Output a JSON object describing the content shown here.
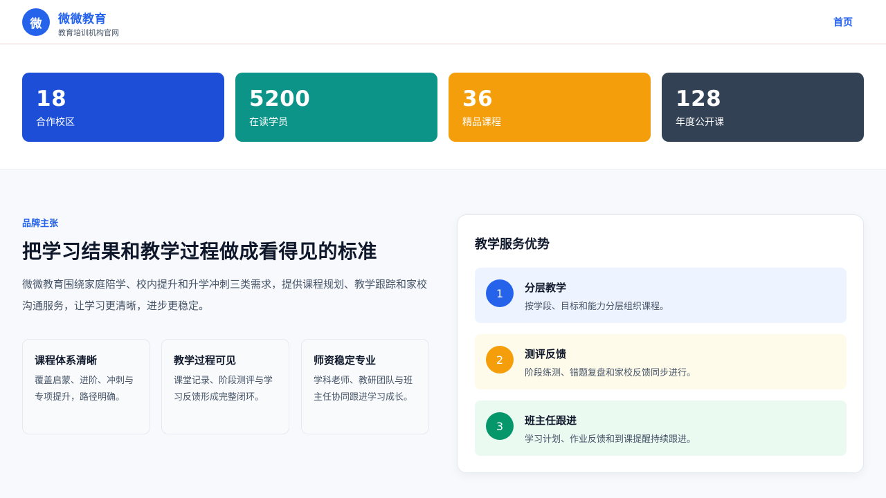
{
  "header": {
    "logo_char": "微",
    "brand_name": "微微教育",
    "brand_subtitle": "教育培训机构官网",
    "nav_home": "首页",
    "accent": "#2563eb"
  },
  "stats": [
    {
      "value": "18",
      "label": "合作校区",
      "color": "#1d4ed8"
    },
    {
      "value": "5200",
      "label": "在读学员",
      "color": "#0d9488"
    },
    {
      "value": "36",
      "label": "精品课程",
      "color": "#f59e0b"
    },
    {
      "value": "128",
      "label": "年度公开课",
      "color": "#334155"
    }
  ],
  "hero": {
    "eyebrow": "品牌主张",
    "headline": "把学习结果和教学过程做成看得见的标准",
    "intro": "微微教育围绕家庭陪学、校内提升和升学冲刺三类需求，提供课程规划、教学跟踪和家校沟通服务，让学习更清晰，进步更稳定。"
  },
  "features": [
    {
      "title": "课程体系清晰",
      "desc": "覆盖启蒙、进阶、冲刺与专项提升，路径明确。"
    },
    {
      "title": "教学过程可见",
      "desc": "课堂记录、阶段测评与学习反馈形成完整闭环。"
    },
    {
      "title": "师资稳定专业",
      "desc": "学科老师、教研团队与班主任协同跟进学习成长。"
    }
  ],
  "advantages": {
    "title": "教学服务优势",
    "items": [
      {
        "num": "1",
        "title": "分层教学",
        "desc": "按学段、目标和能力分层组织课程。",
        "badge_color": "#2563eb",
        "bg_color": "#eef4ff"
      },
      {
        "num": "2",
        "title": "测评反馈",
        "desc": "阶段练测、错题复盘和家校反馈同步进行。",
        "badge_color": "#f59e0b",
        "bg_color": "#fffbea"
      },
      {
        "num": "3",
        "title": "班主任跟进",
        "desc": "学习计划、作业反馈和到课提醒持续跟进。",
        "badge_color": "#059669",
        "bg_color": "#eafaf1"
      }
    ]
  }
}
